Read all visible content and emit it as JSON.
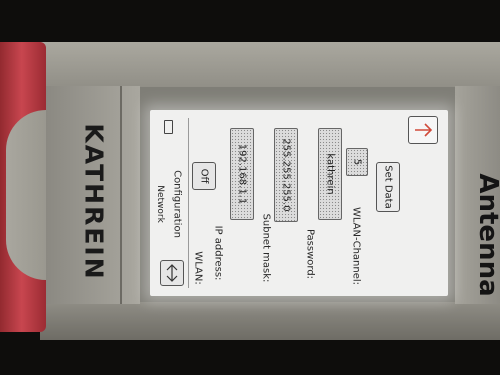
{
  "device": {
    "brand": "KATHREIN",
    "side_label": "Antenna"
  },
  "screen": {
    "header": {
      "title_line1": "Network",
      "title_line2": "Configuration",
      "back_icon": "back-arrow-icon",
      "next_icon": "down-arrow-icon",
      "battery_icon": "battery-icon"
    },
    "wlan": {
      "label": "WLAN:",
      "value": "Off"
    },
    "ip": {
      "label": "IP address:",
      "value": "192.168.1.1"
    },
    "subnet": {
      "label": "Subnet mask:",
      "value": "255.255.255.0"
    },
    "password": {
      "label": "Password:",
      "value": "kathrein"
    },
    "channel": {
      "label": "WLAN-Channel:",
      "value": "5"
    },
    "set_data_label": "Set Data"
  }
}
